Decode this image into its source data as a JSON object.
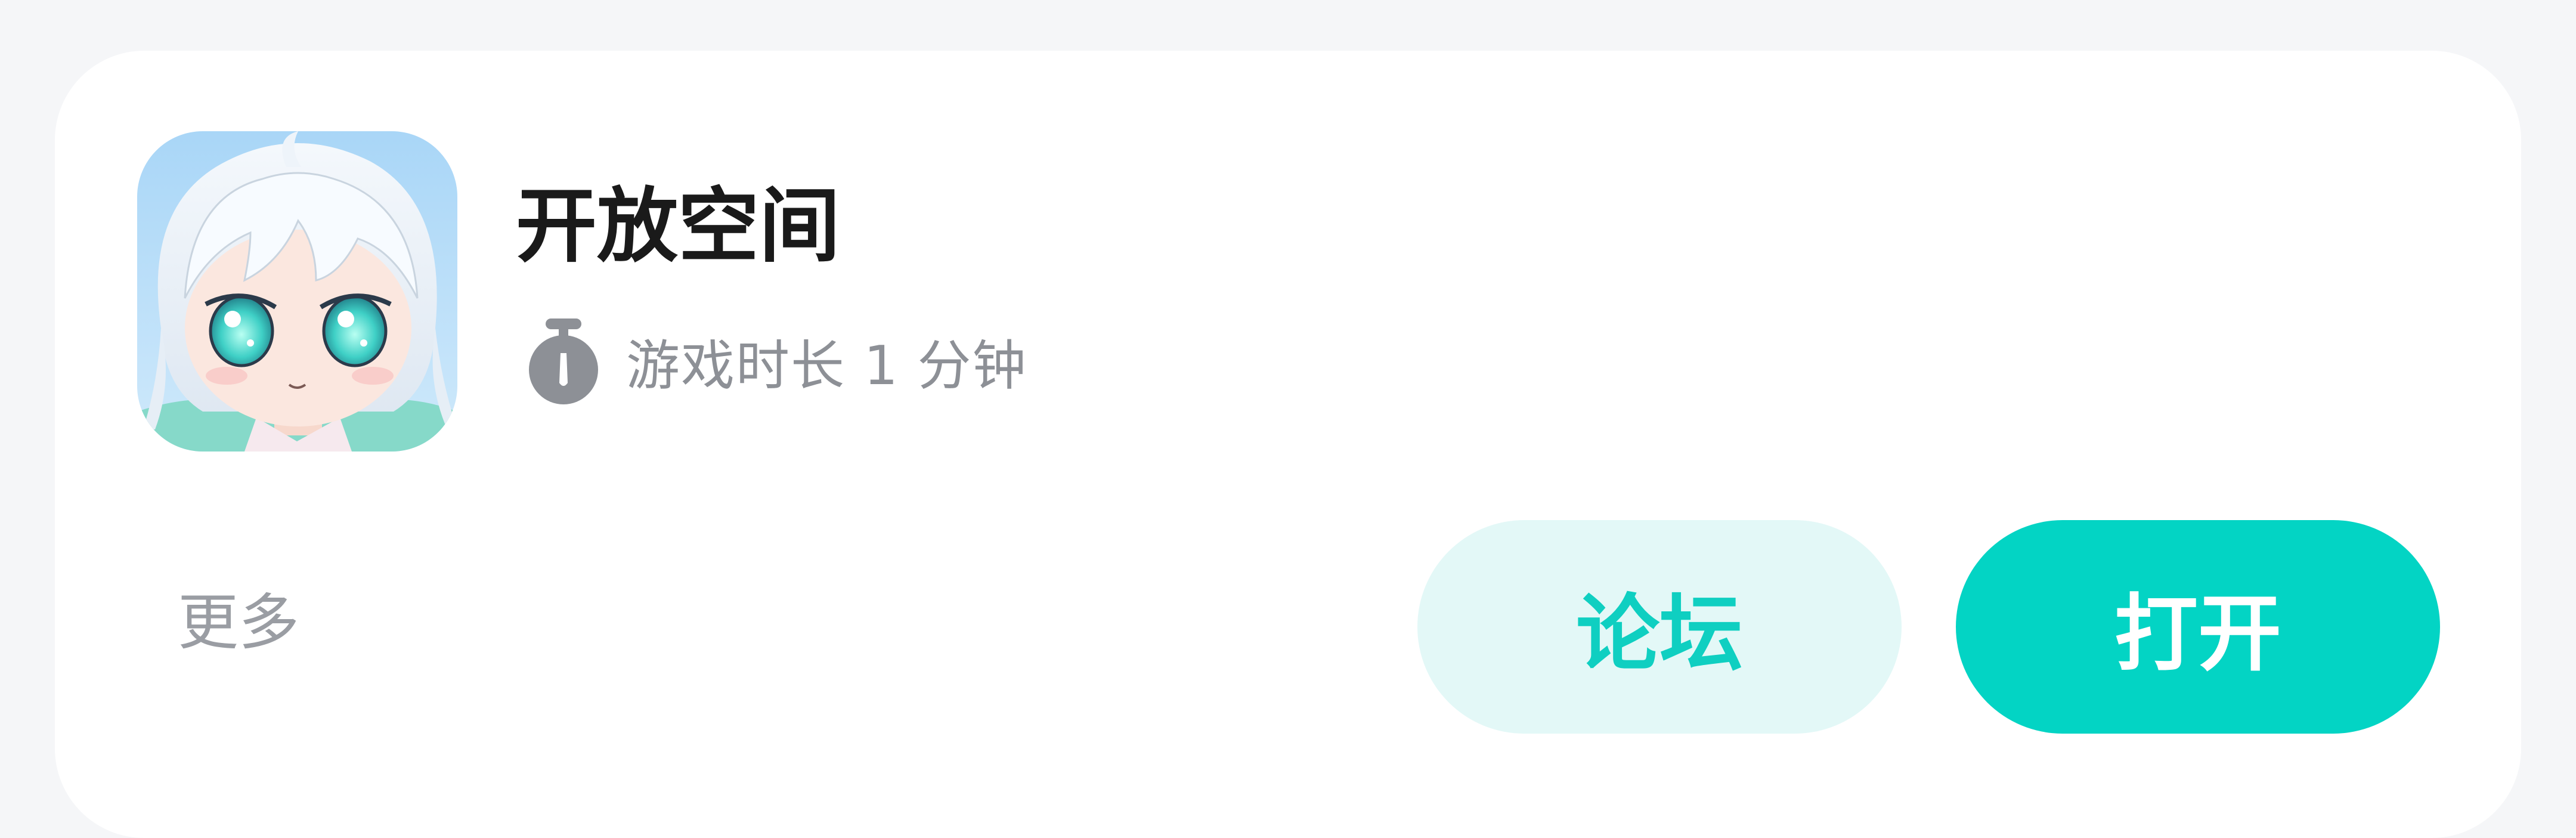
{
  "app": {
    "title": "开放空间",
    "playtime": "游戏时长 1 分钟",
    "icon": "anime-girl-app-icon",
    "playtime_icon": "stopwatch-icon"
  },
  "actions": {
    "more_label": "更多",
    "forum_label": "论坛",
    "open_label": "打开"
  },
  "colors": {
    "accent": "#03d4c4",
    "accent_light": "#e3f8f7",
    "card_bg": "#ffffff",
    "page_bg": "#f5f6f8"
  }
}
